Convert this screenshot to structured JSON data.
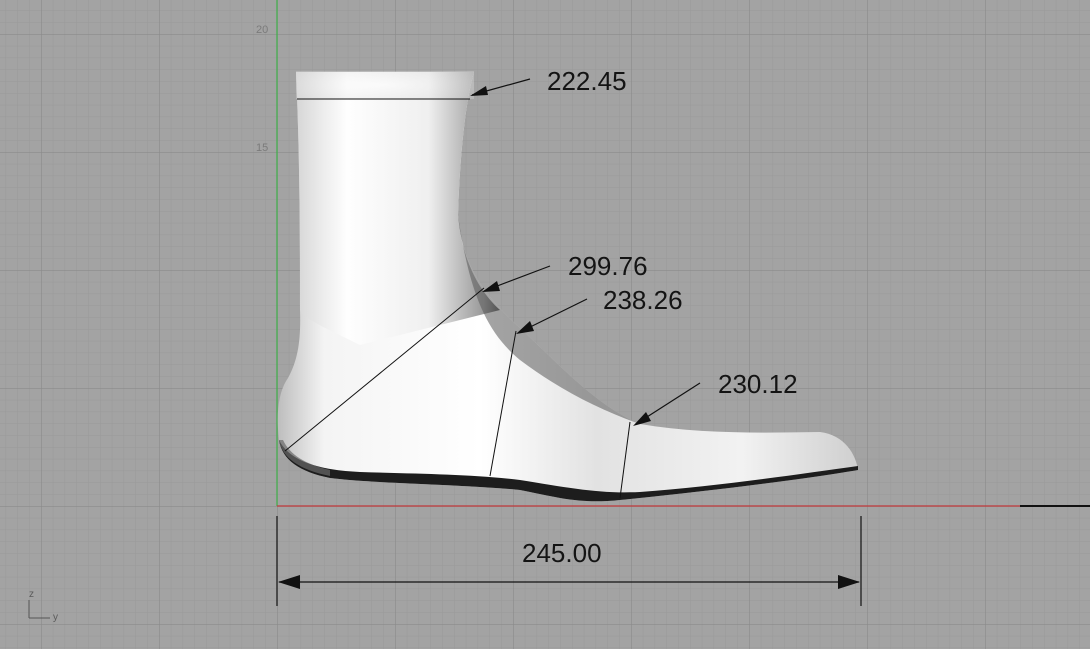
{
  "viewport": {
    "background": "#a3a3a3",
    "grid_minor_color": "#999999",
    "grid_major_color": "#8c8c8c",
    "x_axis_color": "#c0393b",
    "y_axis_color": "#3fae49"
  },
  "axis_ticks": {
    "tick_20": "20",
    "tick_15": "15"
  },
  "dimensions": {
    "ankle_top": "222.45",
    "heel_instep": "299.76",
    "instep": "238.26",
    "ball": "230.12",
    "length": "245.00"
  },
  "axis_widget": {
    "z_label": "z",
    "y_label": "y"
  },
  "model": {
    "name": "foot-last",
    "shade_light": "#f4f4f4",
    "shade_dark": "#2a2a2a"
  }
}
